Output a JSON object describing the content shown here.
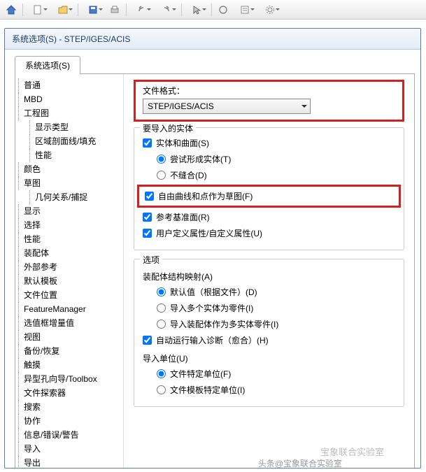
{
  "window": {
    "title": "系统选项(S) - STEP/IGES/ACIS"
  },
  "tab": {
    "label": "系统选项(S)"
  },
  "tree": [
    {
      "label": "普通",
      "indent": 0
    },
    {
      "label": "MBD",
      "indent": 0
    },
    {
      "label": "工程图",
      "indent": 0
    },
    {
      "label": "显示类型",
      "indent": 1
    },
    {
      "label": "区域剖面线/填充",
      "indent": 1
    },
    {
      "label": "性能",
      "indent": 1
    },
    {
      "label": "颜色",
      "indent": 0
    },
    {
      "label": "草图",
      "indent": 0
    },
    {
      "label": "几何关系/捕捉",
      "indent": 1
    },
    {
      "label": "显示",
      "indent": 0
    },
    {
      "label": "选择",
      "indent": 0
    },
    {
      "label": "性能",
      "indent": 0
    },
    {
      "label": "装配体",
      "indent": 0
    },
    {
      "label": "外部参考",
      "indent": 0
    },
    {
      "label": "默认模板",
      "indent": 0
    },
    {
      "label": "文件位置",
      "indent": 0
    },
    {
      "label": "FeatureManager",
      "indent": 0
    },
    {
      "label": "选值框增量值",
      "indent": 0
    },
    {
      "label": "视图",
      "indent": 0
    },
    {
      "label": "备份/恢复",
      "indent": 0
    },
    {
      "label": "触摸",
      "indent": 0
    },
    {
      "label": "异型孔向导/Toolbox",
      "indent": 0
    },
    {
      "label": "文件探索器",
      "indent": 0
    },
    {
      "label": "搜索",
      "indent": 0
    },
    {
      "label": "协作",
      "indent": 0
    },
    {
      "label": "信息/错误/警告",
      "indent": 0
    },
    {
      "label": "导入",
      "indent": 0
    },
    {
      "label": "导出",
      "indent": 0
    }
  ],
  "fileFormat": {
    "label": "文件格式：",
    "value": "STEP/IGES/ACIS"
  },
  "importEntities": {
    "title": "要导入的实体",
    "solidSurface": "实体和曲面(S)",
    "trySolid": "尝试形成实体(T)",
    "noStitch": "不缝合(D)",
    "freeCurves": "自由曲线和点作为草图(F)",
    "refPlane": "参考基准面(R)",
    "customProps": "用户定义属性/自定义属性(U)"
  },
  "options": {
    "title": "选项",
    "assemblyMapping": "装配体结构映射(A)",
    "defaultByFile": "默认值（根据文件）(D)",
    "importMultiAsParts": "导入多个实体为零件(I)",
    "importAssemblyAsMulti": "导入装配体作为多实体零件(I)",
    "autoDiagnostics": "自动运行输入诊断（愈合）(H)",
    "importUnits": "导入单位(U)",
    "fileUnits": "文件特定单位(F)",
    "templateUnits": "文件模板特定单位(I)"
  },
  "watermark1": "宝象联合实验室",
  "watermark2": "头条@宝象联合实验室"
}
